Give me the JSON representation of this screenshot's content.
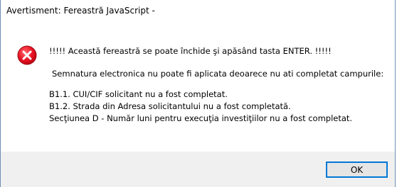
{
  "window": {
    "title": "Avertisment: Fereastră JavaScript -"
  },
  "dialog": {
    "icon": "error-icon",
    "line1": "!!!!! Această fereastră se poate închide şi apăsând tasta ENTER. !!!!!",
    "line2": "Semnatura electronica nu poate fi aplicata deoarece nu ati completat campurile:",
    "errors": [
      "B1.1. CUI/CIF solicitant nu a fost completat.",
      "B1.2. Strada din Adresa solicitantului nu a fost completată.",
      "Secţiunea D - Număr luni pentru execuţia investiţiilor nu a fost completat."
    ]
  },
  "buttons": {
    "ok_label": "OK"
  },
  "colors": {
    "error_red": "#e81123",
    "button_focus": "#0078d7",
    "footer_bg": "#f0f0f0"
  }
}
